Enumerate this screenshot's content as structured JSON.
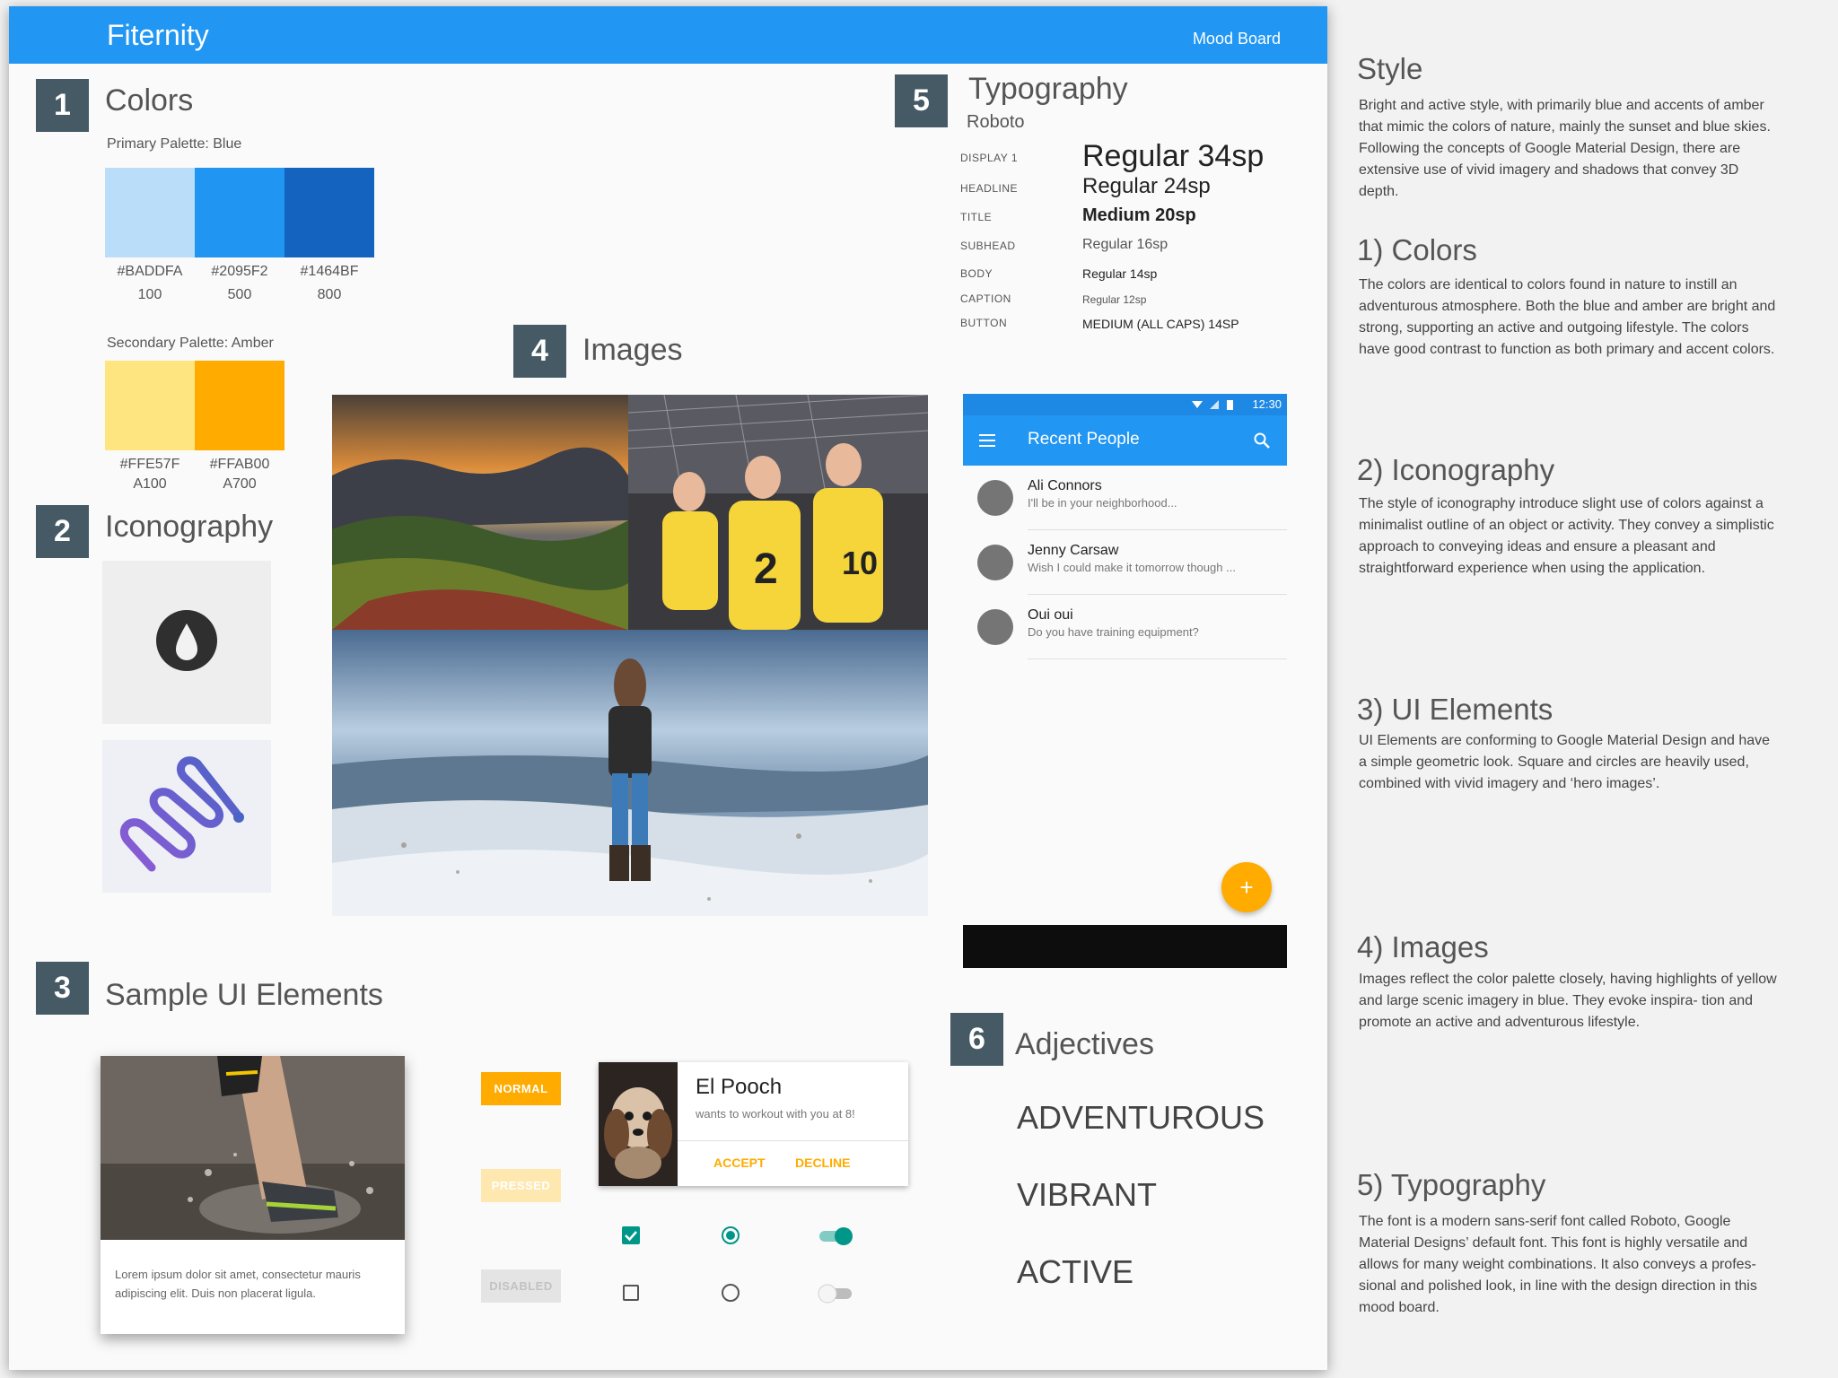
{
  "header": {
    "title": "Fiternity",
    "right_label": "Mood Board"
  },
  "colors": {
    "number": "1",
    "title": "Colors",
    "primary_label": "Primary Palette: Blue",
    "primary": [
      {
        "hex": "#BADDFA",
        "shade": "100"
      },
      {
        "hex": "#2095F2",
        "shade": "500"
      },
      {
        "hex": "#1464BF",
        "shade": "800"
      }
    ],
    "secondary_label": "Secondary Palette: Amber",
    "secondary": [
      {
        "hex": "#FFE57F",
        "shade": "A100"
      },
      {
        "hex": "#FFAB00",
        "shade": "A700"
      }
    ]
  },
  "iconography": {
    "number": "2",
    "title": "Iconography",
    "icons": [
      "water-drop-icon",
      "snake-icon"
    ]
  },
  "images": {
    "number": "4",
    "title": "Images",
    "photos": [
      "sunset-landscape-photo",
      "volleyball-players-photo",
      "snowy-hiker-photo"
    ]
  },
  "typography": {
    "number": "5",
    "title": "Typography",
    "font": "Roboto",
    "styles": [
      {
        "label": "DISPLAY 1",
        "sample": "Regular 34sp"
      },
      {
        "label": "HEADLINE",
        "sample": "Regular 24sp"
      },
      {
        "label": "TITLE",
        "sample": "Medium 20sp"
      },
      {
        "label": "SUBHEAD",
        "sample": "Regular 16sp"
      },
      {
        "label": "BODY",
        "sample": "Regular 14sp"
      },
      {
        "label": "CAPTION",
        "sample": "Regular 12sp"
      },
      {
        "label": "BUTTON",
        "sample": "MEDIUM (ALL CAPS) 14SP"
      }
    ]
  },
  "phone": {
    "time": "12:30",
    "toolbar_title": "Recent People",
    "people": [
      {
        "name": "Ali Connors",
        "message": "I'll be in your neighborhood..."
      },
      {
        "name": "Jenny Carsaw",
        "message": "Wish I could make it tomorrow though ..."
      },
      {
        "name": "Oui oui",
        "message": "Do you have training equipment?"
      }
    ],
    "fab_symbol": "+"
  },
  "sample_ui": {
    "number": "3",
    "title": "Sample UI Elements",
    "card_text": "Lorem ipsum dolor sit amet, consectetur mauris adipiscing elit. Duis non placerat ligula.",
    "buttons": {
      "normal": "NORMAL",
      "pressed": "PRESSED",
      "disabled": "DISABLED"
    },
    "dialog": {
      "title": "El Pooch",
      "subtitle": "wants to workout with you at 8!",
      "accept": "ACCEPT",
      "decline": "DECLINE"
    },
    "checkbox_checked": true,
    "checkbox_unchecked": false,
    "radio_selected": true,
    "radio_unselected": false,
    "switch_on": true,
    "switch_off": false,
    "accent_color": "#009688"
  },
  "adjectives": {
    "number": "6",
    "title": "Adjectives",
    "words": [
      "ADVENTUROUS",
      "VIBRANT",
      "ACTIVE"
    ]
  },
  "sidebar": [
    {
      "heading": "Style",
      "text": "Bright and active style, with primarily blue and accents of amber that mimic the colors of nature, mainly the sunset and blue skies. Following the concepts of Google Material Design, there are extensive use of vivid imagery and shadows that convey 3D depth."
    },
    {
      "heading": "1) Colors",
      "text": "The colors are identical to colors found in nature to instill an adventurous atmosphere. Both the blue and amber are bright and strong, supporting an active and outgoing lifestyle. The colors have good contrast to function as both primary and accent colors."
    },
    {
      "heading": "2) Iconography",
      "text": "The style of iconography introduce slight use of colors against a minimalist outline of an object or activity. They convey a simplistic approach to conveying ideas and ensure a pleasant and straightforward experience when using the application."
    },
    {
      "heading": "3) UI Elements",
      "text": "UI Elements are conforming to Google Material Design and have a simple geometric look. Square and circles are heavily used, combined with vivid imagery and ‘hero images’."
    },
    {
      "heading": "4) Images",
      "text": "Images reflect the color palette closely, having highlights of yellow and large scenic imagery in blue. They evoke inspira- tion and promote an active and adventurous lifestyle."
    },
    {
      "heading": "5) Typography",
      "text": "The font is a modern sans-serif font called Roboto, Google Material Designs’ default font. This font is highly versatile and allows for many weight combinations. It also conveys a profes- sional and polished look, in line with the design direction in this mood board."
    }
  ]
}
